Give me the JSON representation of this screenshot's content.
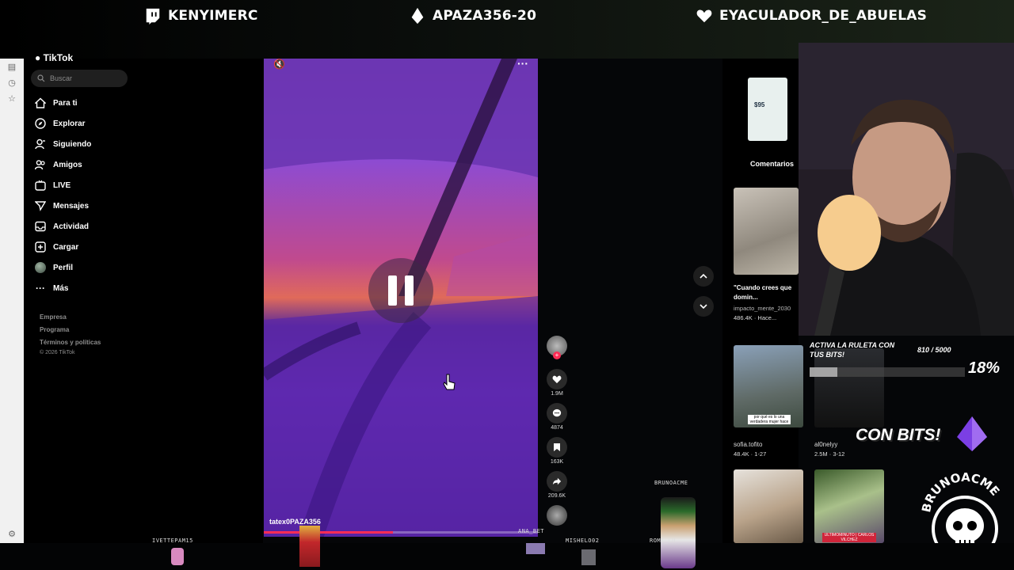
{
  "stream": {
    "top_names": [
      "KENYIMERC",
      "APAZA356-20",
      "EYACULADOR_DE_ABUELAS"
    ],
    "bits_overlay": {
      "title": "ACTIVA LA RULETA CON TUS BITS!",
      "progress_text": "810 / 5000",
      "percent_text": "18%",
      "progress": 0.18,
      "cta": "CON BITS!"
    },
    "watermark": "BRUNOACME",
    "chat_avatars": [
      "IVETTEPAM15",
      "BRUNOACME",
      "ANA_BET",
      "MISHELO02",
      "ROMI_LU"
    ]
  },
  "tiktok": {
    "logo": "TikTok",
    "search_placeholder": "Buscar",
    "nav": [
      {
        "label": "Para ti",
        "icon": "home-icon"
      },
      {
        "label": "Explorar",
        "icon": "compass-icon"
      },
      {
        "label": "Siguiendo",
        "icon": "following-icon"
      },
      {
        "label": "Amigos",
        "icon": "friends-icon"
      },
      {
        "label": "LIVE",
        "icon": "live-icon"
      },
      {
        "label": "Mensajes",
        "icon": "messages-icon"
      },
      {
        "label": "Actividad",
        "icon": "activity-icon"
      },
      {
        "label": "Cargar",
        "icon": "upload-icon"
      },
      {
        "label": "Perfil",
        "icon": "profile-avatar"
      },
      {
        "label": "Más",
        "icon": "more-icon"
      }
    ],
    "footer": [
      "Empresa",
      "Programa",
      "Términos y políticas",
      "© 2026 TikTok"
    ],
    "video": {
      "username": "tatex0PAZA356",
      "likes": "1.9M",
      "comments": "4874",
      "saves": "163K",
      "shares": "209.6K"
    },
    "comments_tab": "Comentarios",
    "price_badge": "$95",
    "feed": [
      {
        "caption": "\"Cuando crees que domin...",
        "user": "impacto_mente_2030",
        "stats": "486.4K · Hace..."
      },
      {
        "caption": "",
        "user": "sofia.tofito",
        "stats": "48.4K · 1-27"
      },
      {
        "caption": "",
        "user": "al0nelyy",
        "stats": "2.5M · 3-12"
      }
    ],
    "thumb_captions": [
      "por qué es lo una verdadera mujer hace",
      "ULTIMOMINUTO | CARLOS VILCHEZ"
    ]
  },
  "colors": {
    "accent": "#fe2c55",
    "purple": "#8a4bd6",
    "overlay_purple": "#7b3fe4"
  }
}
